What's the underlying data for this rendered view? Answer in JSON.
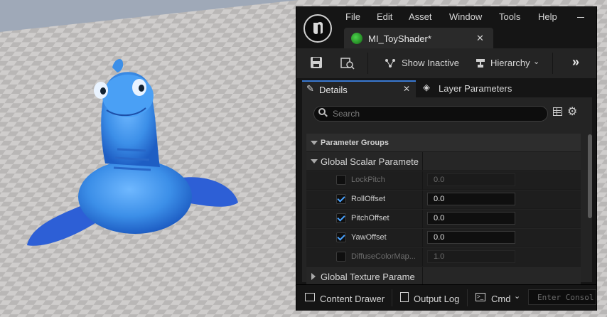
{
  "menu": {
    "items": [
      "File",
      "Edit",
      "Asset",
      "Window",
      "Tools",
      "Help"
    ]
  },
  "document_tab": {
    "title": "MI_ToyShader*"
  },
  "toolbar": {
    "show_inactive": "Show Inactive",
    "hierarchy": "Hierarchy"
  },
  "panels": {
    "details": "Details",
    "layer_parameters": "Layer Parameters"
  },
  "search": {
    "placeholder": "Search"
  },
  "sections": {
    "parameter_groups": "Parameter Groups",
    "global_scalar": "Global Scalar Paramete",
    "global_texture": "Global Texture Parame"
  },
  "params": [
    {
      "label": "LockPitch",
      "value": "0.0",
      "checked": false,
      "enabled": false
    },
    {
      "label": "RollOffset",
      "value": "0.0",
      "checked": true,
      "enabled": true
    },
    {
      "label": "PitchOffset",
      "value": "0.0",
      "checked": true,
      "enabled": true
    },
    {
      "label": "YawOffset",
      "value": "0.0",
      "checked": true,
      "enabled": true
    },
    {
      "label": "DiffuseColorMap...",
      "value": "1.0",
      "checked": false,
      "enabled": false
    }
  ],
  "statusbar": {
    "content_drawer": "Content Drawer",
    "output_log": "Output Log",
    "cmd": "Cmd",
    "console_placeholder": "Enter Consol"
  },
  "colors": {
    "accent_blue": "#4aa3ff",
    "panel_bg": "#242424",
    "window_bg": "#151515"
  }
}
